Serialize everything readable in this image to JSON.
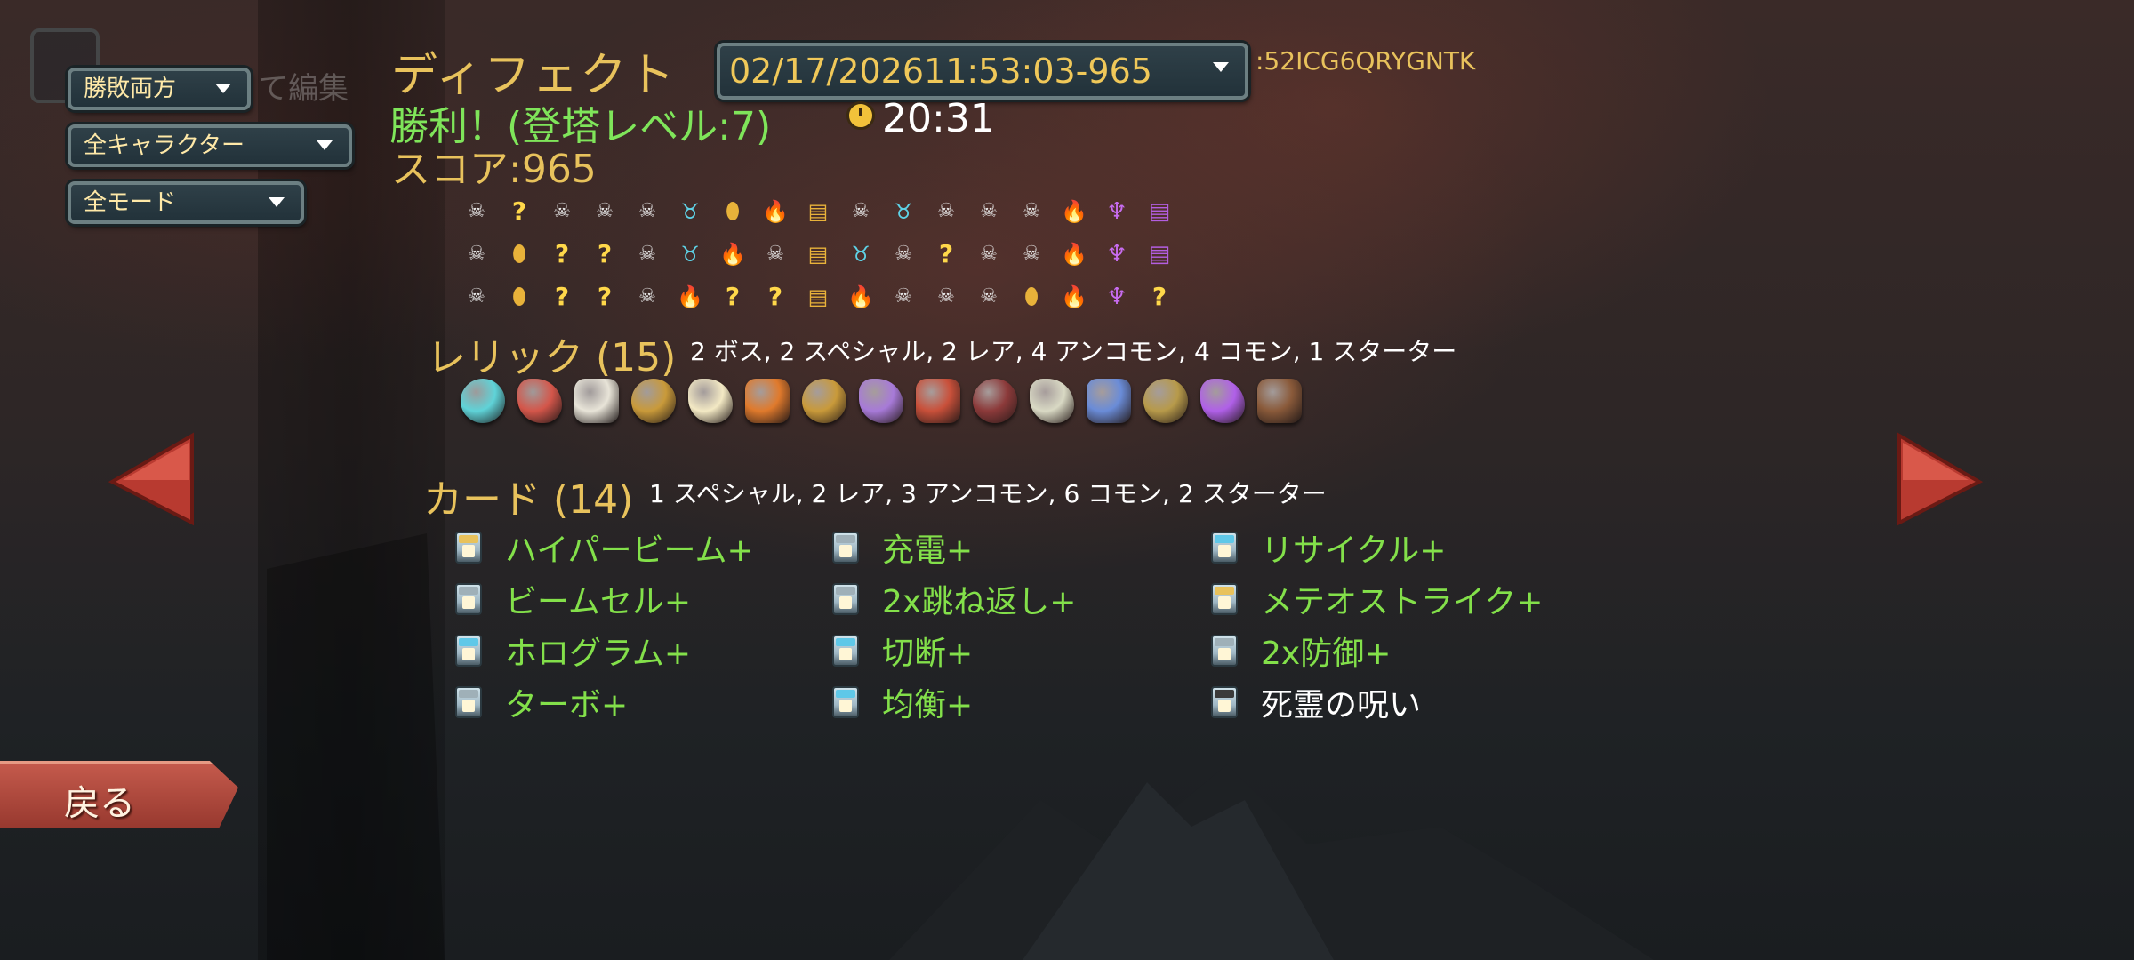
{
  "filters": {
    "outcome": "勝敗両方",
    "character": "全キャラクター",
    "mode": "全モード",
    "edit_ghost": "て編集"
  },
  "run": {
    "title": "ディフェクト",
    "seed_date": "02/17/202611:53:03-965",
    "seed_code": ":52ICG6QRYGNTK",
    "result": "勝利！(登塔レベル:7)",
    "time": "20:31",
    "score": "スコア:965"
  },
  "path_rows": [
    [
      "monster",
      "unknown",
      "monster",
      "monster",
      "monster",
      "elite",
      "shop",
      "rest",
      "treasure",
      "monster",
      "elite",
      "monster",
      "monster",
      "monster",
      "rest",
      "boss",
      "bosschest"
    ],
    [
      "monster",
      "shop",
      "unknown",
      "unknown",
      "monster",
      "elite",
      "rest",
      "monster",
      "treasure",
      "elite",
      "monster",
      "unknown",
      "monster",
      "monster",
      "rest",
      "boss",
      "bosschest"
    ],
    [
      "monster",
      "shop",
      "unknown",
      "unknown",
      "monster",
      "rest",
      "unknown",
      "unknown",
      "treasure",
      "rest",
      "monster",
      "monster",
      "monster",
      "shop",
      "rest",
      "boss",
      "unknown"
    ]
  ],
  "path_icons": {
    "monster": "☠",
    "unknown": "?",
    "elite": "♉",
    "shop": "⬮",
    "rest": "🔥",
    "treasure": "▤",
    "boss": "♆",
    "bosschest": "▤"
  },
  "relics": {
    "title": "レリック (15)",
    "summary": "2 ボス, 2 スペシャル, 2 レア, 4 アンコモン, 4 コモン, 1 スターター",
    "items": [
      {
        "name": "cracked-core-icon",
        "color": "#5fd3d8"
      },
      {
        "name": "claw-icon",
        "color": "#d4564a"
      },
      {
        "name": "bird-bone-icon",
        "color": "#e8e4d8"
      },
      {
        "name": "ring-band-icon",
        "color": "#c99a3a"
      },
      {
        "name": "orb-icon",
        "color": "#f3e9c4"
      },
      {
        "name": "flame-jar-icon",
        "color": "#e07a2c"
      },
      {
        "name": "sundial-icon",
        "color": "#c99a3a"
      },
      {
        "name": "stone-egg-icon",
        "color": "#a77ad8"
      },
      {
        "name": "meat-icon",
        "color": "#c9503a"
      },
      {
        "name": "book-icon",
        "color": "#8c3a3a"
      },
      {
        "name": "cage-icon",
        "color": "#d9d9c4"
      },
      {
        "name": "bed-icon",
        "color": "#6a8cd8"
      },
      {
        "name": "emblem-icon",
        "color": "#b79a4a"
      },
      {
        "name": "shuriken-icon",
        "color": "#b060e8"
      },
      {
        "name": "branch-icon",
        "color": "#8a5a3a"
      }
    ]
  },
  "cards": {
    "title": "カード (14)",
    "summary": "1 スペシャル, 2 レア, 3 アンコモン, 6 コモン, 2 スターター",
    "items": [
      {
        "name": "ハイパービーム+",
        "band": "#e8c25c",
        "curse": false
      },
      {
        "name": "充電+",
        "band": "#9fb0b8",
        "curse": false
      },
      {
        "name": "リサイクル+",
        "band": "#5fc8e8",
        "curse": false
      },
      {
        "name": "ビームセル+",
        "band": "#9fb0b8",
        "curse": false
      },
      {
        "name": "2x跳ね返し+",
        "band": "#9fb0b8",
        "curse": false
      },
      {
        "name": "メテオストライク+",
        "band": "#e8c25c",
        "curse": false
      },
      {
        "name": "ホログラム+",
        "band": "#5fc8e8",
        "curse": false
      },
      {
        "name": "切断+",
        "band": "#5fc8e8",
        "curse": false
      },
      {
        "name": "2x防御+",
        "band": "#9fb0b8",
        "curse": false
      },
      {
        "name": "ターボ+",
        "band": "#9fb0b8",
        "curse": false
      },
      {
        "name": "均衡+",
        "band": "#5fc8e8",
        "curse": false
      },
      {
        "name": "死霊の呪い",
        "band": "#3a3a3a",
        "curse": true
      }
    ]
  },
  "nav": {
    "back": "戻る"
  }
}
